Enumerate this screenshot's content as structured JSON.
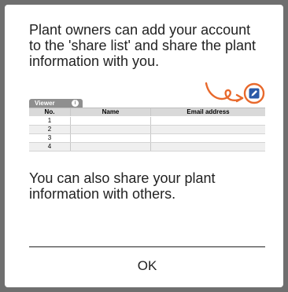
{
  "dialog": {
    "intro_text": "Plant owners can add your account to the 'share list' and share the plant information with you.",
    "outro_text": "You can also share your plant information with others.",
    "ok_label": "OK"
  },
  "illustration": {
    "tab_label": "Viewer",
    "info_glyph": "i",
    "columns": [
      "No.",
      "Name",
      "Email address"
    ],
    "rows": [
      {
        "no": "1",
        "name": "",
        "email": ""
      },
      {
        "no": "2",
        "name": "",
        "email": ""
      },
      {
        "no": "3",
        "name": "",
        "email": ""
      },
      {
        "no": "4",
        "name": "",
        "email": ""
      }
    ],
    "icons": {
      "edit": "pencil-icon",
      "info": "info-icon",
      "pointer": "curved-arrow-icon"
    },
    "colors": {
      "highlight": "#e8692c",
      "edit_button": "#2a5aa8",
      "tab": "#8f8f8f"
    }
  }
}
